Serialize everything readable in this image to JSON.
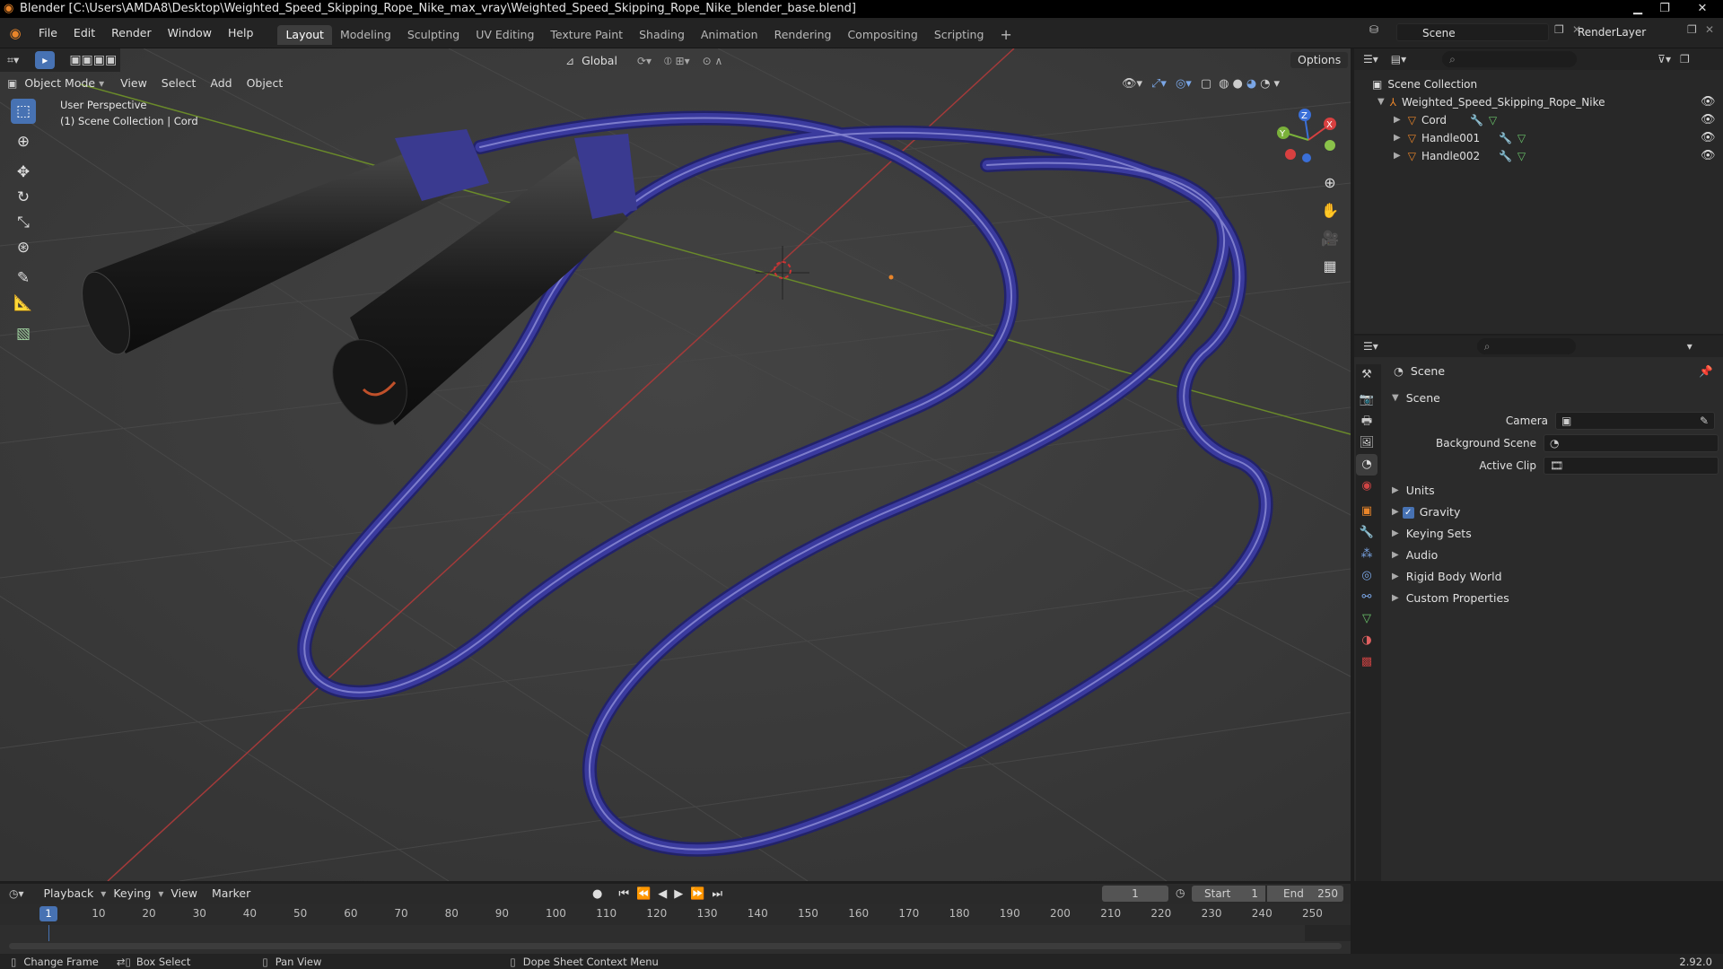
{
  "title_bar": {
    "title": "Blender [C:\\Users\\AMDA8\\Desktop\\Weighted_Speed_Skipping_Rope_Nike_max_vray\\Weighted_Speed_Skipping_Rope_Nike_blender_base.blend]"
  },
  "menus": [
    "File",
    "Edit",
    "Render",
    "Window",
    "Help"
  ],
  "workspaces": [
    {
      "label": "Layout",
      "active": true
    },
    {
      "label": "Modeling"
    },
    {
      "label": "Sculpting"
    },
    {
      "label": "UV Editing"
    },
    {
      "label": "Texture Paint"
    },
    {
      "label": "Shading"
    },
    {
      "label": "Animation"
    },
    {
      "label": "Rendering"
    },
    {
      "label": "Compositing"
    },
    {
      "label": "Scripting"
    }
  ],
  "scene_field": "Scene",
  "renderlayer_field": "RenderLayer",
  "viewport": {
    "mode": "Object Mode",
    "header_menus": [
      "View",
      "Select",
      "Add",
      "Object"
    ],
    "transform_orientation": "Global",
    "options_label": "Options",
    "overlay_line1": "User Perspective",
    "overlay_line2": "(1) Scene Collection | Cord"
  },
  "outliner": {
    "root": "Scene Collection",
    "collection": "Weighted_Speed_Skipping_Rope_Nike",
    "objects": [
      "Cord",
      "Handle001",
      "Handle002"
    ]
  },
  "properties": {
    "context_title": "Scene",
    "panel_title": "Scene",
    "fields": [
      {
        "label": "Camera"
      },
      {
        "label": "Background Scene"
      },
      {
        "label": "Active Clip"
      }
    ],
    "subpanels": [
      {
        "label": "Units",
        "checkbox": false
      },
      {
        "label": "Gravity",
        "checkbox": true
      },
      {
        "label": "Keying Sets",
        "checkbox": false
      },
      {
        "label": "Audio",
        "checkbox": false
      },
      {
        "label": "Rigid Body World",
        "checkbox": false
      },
      {
        "label": "Custom Properties",
        "checkbox": false
      }
    ]
  },
  "timeline": {
    "menus": [
      "Playback",
      "Keying",
      "View",
      "Marker"
    ],
    "current_frame": "1",
    "start_label": "Start",
    "start_value": "1",
    "end_label": "End",
    "end_value": "250",
    "ruler": [
      "10",
      "20",
      "30",
      "40",
      "50",
      "60",
      "70",
      "80",
      "90",
      "100",
      "110",
      "120",
      "130",
      "140",
      "150",
      "160",
      "170",
      "180",
      "190",
      "200",
      "210",
      "220",
      "230",
      "240",
      "250"
    ],
    "playhead": "1"
  },
  "status_bar": {
    "items": [
      "Change Frame",
      "Box Select",
      "Pan View",
      "Dope Sheet Context Menu"
    ],
    "version": "2.92.0"
  },
  "colors": {
    "accent": "#4772b3",
    "rope": "#3a3a9e",
    "object_orange": "#e9852a"
  }
}
